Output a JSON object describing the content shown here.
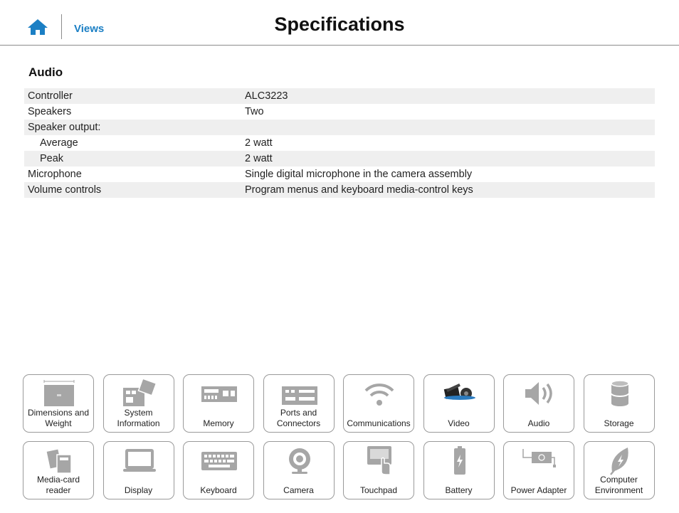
{
  "header": {
    "home_icon": "home-icon",
    "views_label": "Views",
    "title": "Specifications"
  },
  "section": {
    "title": "Audio"
  },
  "specs": [
    {
      "label": "Controller",
      "value": "ALC3223"
    },
    {
      "label": "Speakers",
      "value": "Two"
    },
    {
      "label": "Speaker output:",
      "value": ""
    },
    {
      "label": "Average",
      "value": "2 watt"
    },
    {
      "label": "Peak",
      "value": "2 watt"
    },
    {
      "label": "Microphone",
      "value": "Single digital microphone in the camera assembly"
    },
    {
      "label": "Volume controls",
      "value": "Program menus and keyboard media-control keys"
    }
  ],
  "tiles": [
    {
      "icon": "dimensions-icon",
      "line1": "Dimensions and",
      "line2": "Weight"
    },
    {
      "icon": "system-information-icon",
      "line1": "System",
      "line2": "Information"
    },
    {
      "icon": "memory-icon",
      "line1": "Memory",
      "line2": ""
    },
    {
      "icon": "ports-icon",
      "line1": "Ports and",
      "line2": "Connectors"
    },
    {
      "icon": "wifi-icon",
      "line1": "Communications",
      "line2": ""
    },
    {
      "icon": "video-icon",
      "line1": "Video",
      "line2": ""
    },
    {
      "icon": "speaker-icon",
      "line1": "Audio",
      "line2": ""
    },
    {
      "icon": "storage-icon",
      "line1": "Storage",
      "line2": ""
    },
    {
      "icon": "media-card-icon",
      "line1": "Media-card",
      "line2": "reader"
    },
    {
      "icon": "display-icon",
      "line1": "Display",
      "line2": ""
    },
    {
      "icon": "keyboard-icon",
      "line1": "Keyboard",
      "line2": ""
    },
    {
      "icon": "camera-icon",
      "line1": "Camera",
      "line2": ""
    },
    {
      "icon": "touchpad-icon",
      "line1": "Touchpad",
      "line2": ""
    },
    {
      "icon": "battery-icon",
      "line1": "Battery",
      "line2": ""
    },
    {
      "icon": "power-adapter-icon",
      "line1": "Power Adapter",
      "line2": ""
    },
    {
      "icon": "leaf-icon",
      "line1": "Computer",
      "line2": "Environment"
    }
  ],
  "colors": {
    "accent": "#1b7fc4",
    "row_alt": "#efefef",
    "icon_gray": "#a6a6a6",
    "border": "#9a9a9a"
  }
}
